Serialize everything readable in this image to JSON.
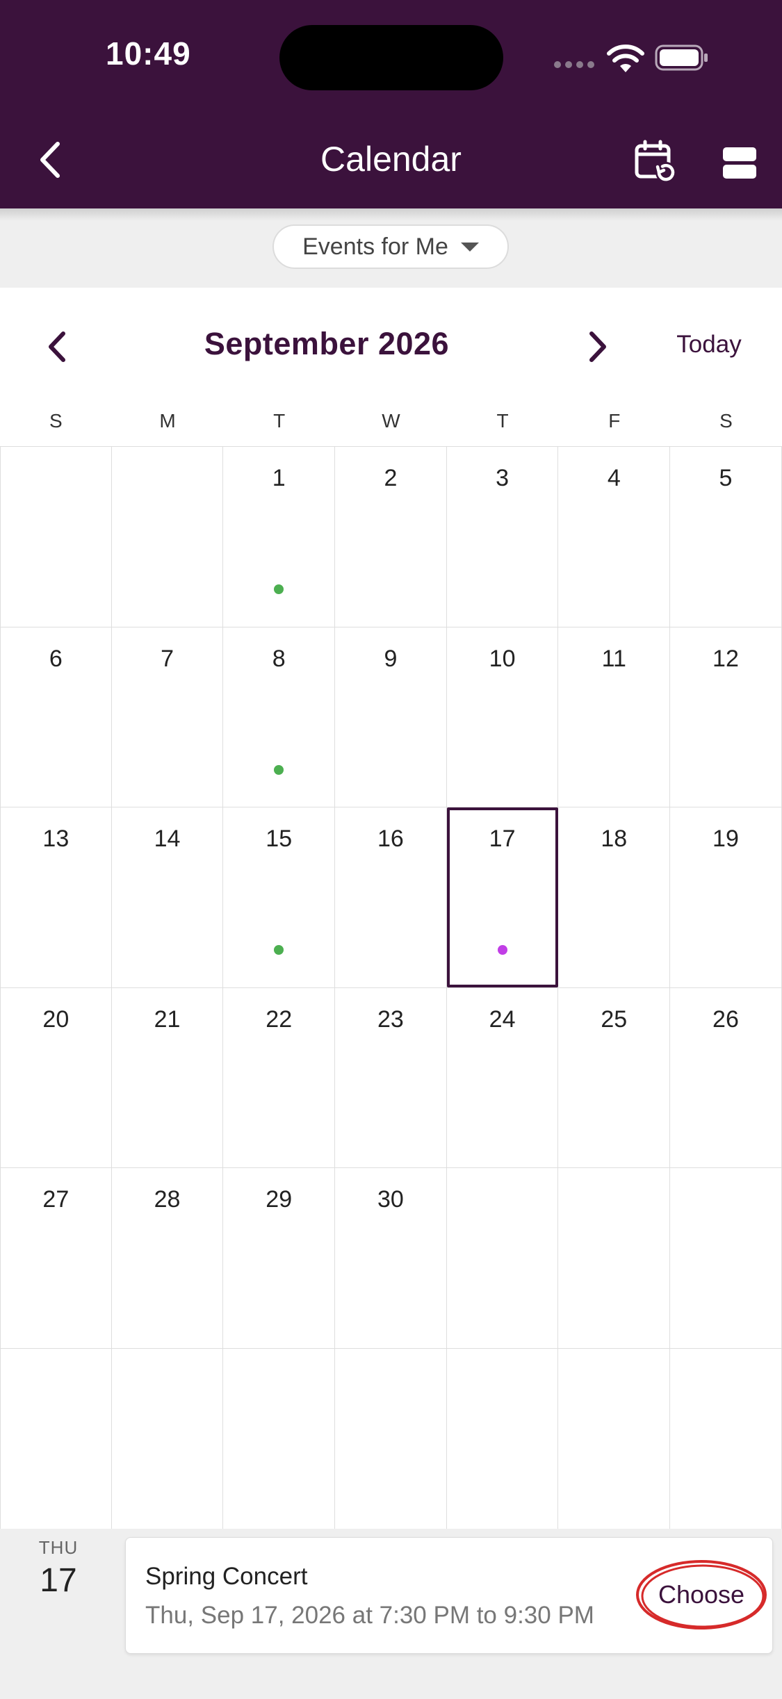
{
  "status_bar": {
    "time": "10:49"
  },
  "header": {
    "title": "Calendar",
    "back_icon": "chevron-left-icon",
    "refresh_icon": "calendar-refresh-icon",
    "view_icon": "view-toggle-icon"
  },
  "filter": {
    "label": "Events for Me"
  },
  "calendar": {
    "month_label": "September 2026",
    "today_label": "Today",
    "weekdays": [
      "S",
      "M",
      "T",
      "W",
      "T",
      "F",
      "S"
    ],
    "weeks": [
      [
        "",
        "",
        "1",
        "2",
        "3",
        "4",
        "5"
      ],
      [
        "6",
        "7",
        "8",
        "9",
        "10",
        "11",
        "12"
      ],
      [
        "13",
        "14",
        "15",
        "16",
        "17",
        "18",
        "19"
      ],
      [
        "20",
        "21",
        "22",
        "23",
        "24",
        "25",
        "26"
      ],
      [
        "27",
        "28",
        "29",
        "30",
        "",
        "",
        ""
      ],
      [
        "",
        "",
        "",
        "",
        "",
        "",
        ""
      ]
    ],
    "selected_day": "17",
    "event_dots": {
      "1": "#4caf50",
      "8": "#4caf50",
      "15": "#4caf50",
      "17": "#c13ee6"
    },
    "colors": {
      "accent": "#3b123c",
      "past_event": "#4caf50",
      "selected_event": "#c13ee6"
    }
  },
  "selected_day_panel": {
    "dow": "THU",
    "day": "17",
    "event": {
      "title": "Spring Concert",
      "time": "Thu, Sep 17, 2026 at 7:30 PM to 9:30 PM",
      "action_label": "Choose"
    }
  }
}
